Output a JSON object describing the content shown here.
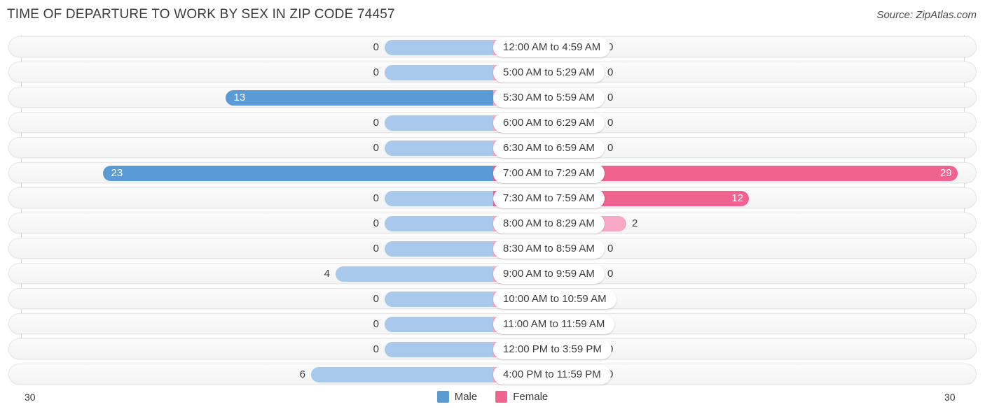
{
  "header": {
    "title": "TIME OF DEPARTURE TO WORK BY SEX IN ZIP CODE 74457",
    "source": "Source: ZipAtlas.com"
  },
  "legend": {
    "male_label": "Male",
    "female_label": "Female",
    "male_color": "#5b9bd5",
    "female_color": "#f0628f",
    "male_color_light": "#a8c8ec",
    "female_color_light": "#f8a8c4"
  },
  "axis": {
    "left_label": "30",
    "right_label": "30",
    "max": 30
  },
  "chart_data": {
    "type": "bar",
    "title": "TIME OF DEPARTURE TO WORK BY SEX IN ZIP CODE 74457",
    "subtitle": "",
    "xlabel": "",
    "ylabel": "",
    "orientation": "horizontal-diverging",
    "grid": true,
    "legend_position": "bottom-center",
    "axis_ticks": [
      "30",
      "30"
    ],
    "xlim": [
      30,
      30
    ],
    "categories": [
      "12:00 AM to 4:59 AM",
      "5:00 AM to 5:29 AM",
      "5:30 AM to 5:59 AM",
      "6:00 AM to 6:29 AM",
      "6:30 AM to 6:59 AM",
      "7:00 AM to 7:29 AM",
      "7:30 AM to 7:59 AM",
      "8:00 AM to 8:29 AM",
      "8:30 AM to 8:59 AM",
      "9:00 AM to 9:59 AM",
      "10:00 AM to 10:59 AM",
      "11:00 AM to 11:59 AM",
      "12:00 PM to 3:59 PM",
      "4:00 PM to 11:59 PM"
    ],
    "series": [
      {
        "name": "Male",
        "values": [
          0,
          0,
          13,
          0,
          0,
          23,
          0,
          0,
          0,
          4,
          0,
          0,
          0,
          6
        ]
      },
      {
        "name": "Female",
        "values": [
          0,
          0,
          0,
          0,
          0,
          29,
          12,
          2,
          0,
          0,
          0,
          0,
          0,
          0
        ]
      }
    ]
  }
}
